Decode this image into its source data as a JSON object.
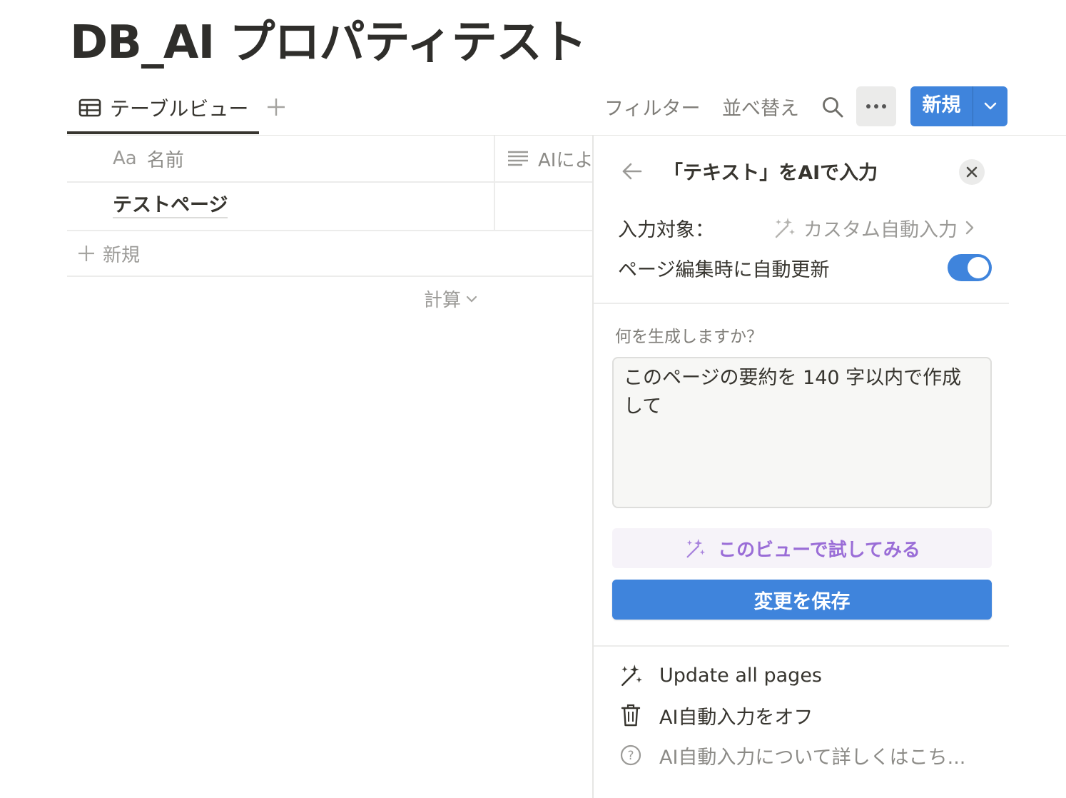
{
  "page": {
    "title": "DB_AI プロパティテスト"
  },
  "toolbar": {
    "view_tab_label": "テーブルビュー",
    "add_view_icon": "plus-icon",
    "filter_label": "フィルター",
    "sort_label": "並べ替え",
    "search_icon": "search-icon",
    "more_icon": "ellipsis-icon",
    "new_label": "新規",
    "new_dropdown_icon": "chevron-down-icon"
  },
  "table": {
    "columns": [
      {
        "icon": "Aa",
        "label": "名前"
      },
      {
        "icon": "text-lines-icon",
        "label": "AIによ"
      }
    ],
    "rows": [
      {
        "name": "テストページ"
      }
    ],
    "new_row_label": "新規",
    "calculate_label": "計算"
  },
  "panel": {
    "title": "「テキスト」をAIで入力",
    "target_label": "入力対象：",
    "target_value": "カスタム自動入力",
    "auto_update_label": "ページ編集時に自動更新",
    "auto_update_on": true,
    "prompt_label": "何を生成しますか？",
    "prompt_value": "このページの要約を 140 字以内で作成して",
    "try_label": "このビューで試してみる",
    "save_label": "変更を保存",
    "menu": {
      "update_all": "Update all pages",
      "turn_off": "AI自動入力をオフ",
      "learn_more": "AI自動入力について詳しくはこち..."
    }
  },
  "colors": {
    "accent_blue": "#3f84dc",
    "ai_purple": "#9a6dd7",
    "text_primary": "#37352f",
    "text_muted": "#9b9a97"
  }
}
